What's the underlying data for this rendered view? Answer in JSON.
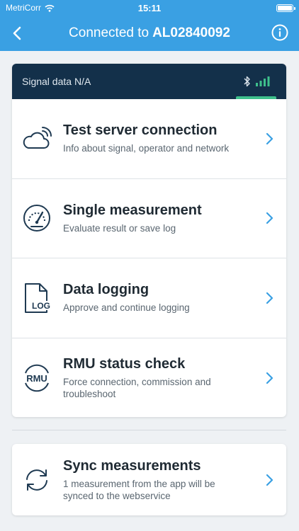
{
  "status_bar": {
    "carrier": "MetriCorr",
    "time": "15:11"
  },
  "nav": {
    "title_prefix": "Connected to",
    "device_id": "AL02840092"
  },
  "signal": {
    "label": "Signal data N/A"
  },
  "menu": [
    {
      "title": "Test server connection",
      "subtitle": "Info about signal, operator and network",
      "icon": "cloud-signal-icon"
    },
    {
      "title": "Single measurement",
      "subtitle": "Evaluate result or save log",
      "icon": "gauge-icon"
    },
    {
      "title": "Data logging",
      "subtitle": "Approve and continue logging",
      "icon": "log-file-icon",
      "icon_text": "LOG"
    },
    {
      "title": "RMU status check",
      "subtitle": "Force connection, commission and troubleshoot",
      "icon": "rmu-icon",
      "icon_text": "RMU"
    }
  ],
  "sync": {
    "title": "Sync measurements",
    "subtitle": "1 measurement from the app will be synced to the webservice",
    "icon": "sync-icon"
  },
  "colors": {
    "primary": "#3aa0e3",
    "header_dark": "#13304a",
    "signal_green": "#3ec08c"
  }
}
